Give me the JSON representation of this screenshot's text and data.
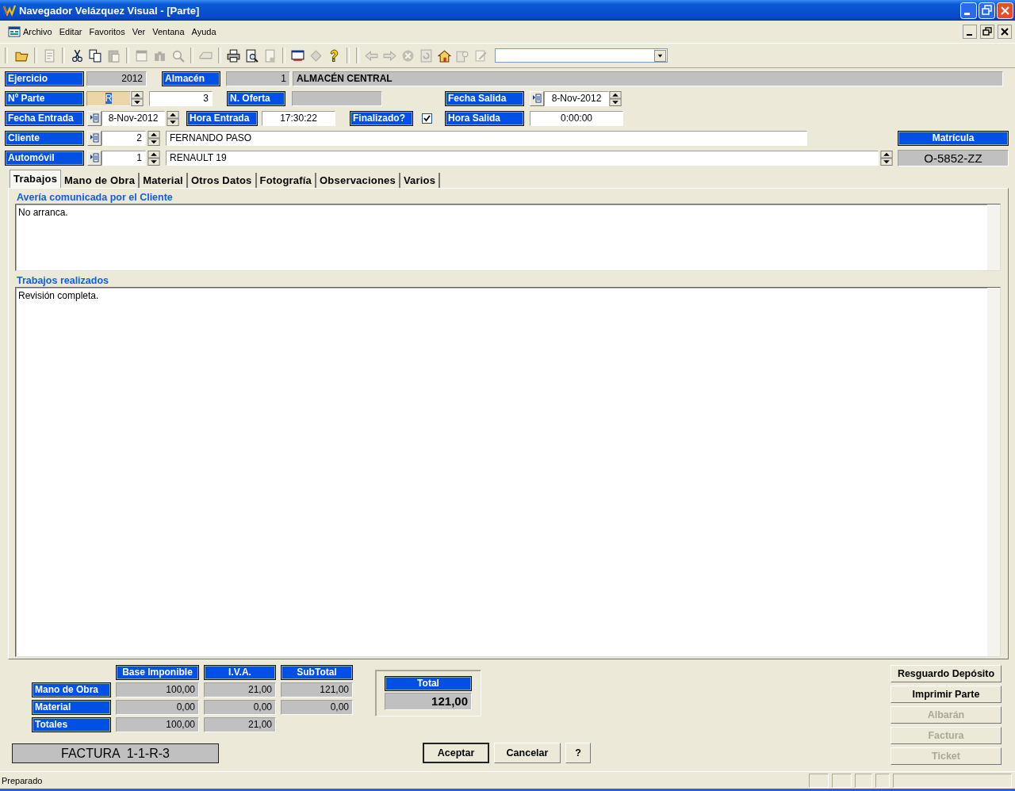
{
  "window": {
    "title": "Navegador Velázquez Visual - [Parte]"
  },
  "menu": [
    {
      "label": "Archivo"
    },
    {
      "label": "Editar"
    },
    {
      "label": "Favoritos"
    },
    {
      "label": "Ver"
    },
    {
      "label": "Ventana"
    },
    {
      "label": "Ayuda"
    }
  ],
  "toolbar": [
    {
      "buttons": [
        {
          "disabled": false
        }
      ]
    },
    {
      "buttons": [
        {
          "disabled": true
        }
      ]
    },
    {
      "buttons": [
        {
          "disabled": false
        },
        {
          "disabled": false
        },
        {
          "disabled": true
        }
      ]
    },
    {
      "buttons": [
        {
          "disabled": true
        },
        {
          "disabled": true
        },
        {
          "disabled": true
        }
      ]
    },
    {
      "buttons": [
        {
          "disabled": true
        }
      ]
    },
    {
      "buttons": [
        {
          "disabled": false
        },
        {
          "disabled": false
        },
        {
          "disabled": true
        }
      ]
    },
    {
      "buttons": [
        {
          "disabled": false
        },
        {
          "disabled": true
        },
        {
          "disabled": false
        }
      ]
    },
    {
      "buttons": [
        {
          "disabled": true
        },
        {
          "disabled": true
        },
        {
          "disabled": true
        },
        {
          "disabled": true
        },
        {
          "disabled": false
        },
        {
          "disabled": true
        },
        {
          "disabled": true
        }
      ]
    }
  ],
  "form": {
    "ejercicio": {
      "label": "Ejercicio",
      "value": "2012"
    },
    "almacen": {
      "label": "Almacén",
      "code": "1",
      "name": "ALMACÉN CENTRAL"
    },
    "parte": {
      "label": "Nº Parte",
      "serie": "R",
      "serie_selected": true,
      "number": "3"
    },
    "oferta": {
      "label": "N. Oferta"
    },
    "fecha_salida": {
      "label": "Fecha Salida",
      "value": "8-Nov-2012"
    },
    "fecha_entrada": {
      "label": "Fecha Entrada",
      "value": "8-Nov-2012"
    },
    "hora_entrada": {
      "label": "Hora Entrada",
      "value": "17:30:22"
    },
    "finalizado": {
      "label": "Finalizado?",
      "checked": true
    },
    "hora_salida": {
      "label": "Hora Salida",
      "value": "0:00:00"
    },
    "cliente": {
      "label": "Cliente",
      "code": "2",
      "name": "FERNANDO PASO"
    },
    "matricula": {
      "label": "Matrícula",
      "value": "O-5852-ZZ"
    },
    "automovil": {
      "label": "Automóvil",
      "code": "1",
      "name": "RENAULT 19"
    }
  },
  "tabs": [
    {
      "label": "Trabajos",
      "selected": true
    },
    {
      "label": "Mano de Obra",
      "selected": false
    },
    {
      "label": "Material",
      "selected": false
    },
    {
      "label": "Otros Datos",
      "selected": false
    },
    {
      "label": "Fotografía",
      "selected": false
    },
    {
      "label": "Observaciones",
      "selected": false
    },
    {
      "label": "Varios",
      "selected": false
    }
  ],
  "panel": {
    "averia": {
      "label": "Avería comunicada por el Cliente",
      "value": "No arranca."
    },
    "trabajos": {
      "label": "Trabajos realizados",
      "value": "Revisión completa."
    }
  },
  "totals": {
    "columns": [
      "Base Imponible",
      "I.V.A.",
      "SubTotal"
    ],
    "rows": [
      {
        "label": "Mano de Obra",
        "values": [
          "100,00",
          "21,00",
          "121,00"
        ]
      },
      {
        "label": "Material",
        "values": [
          "0,00",
          "0,00",
          "0,00"
        ]
      },
      {
        "label": "Totales",
        "values": [
          "100,00",
          "21,00"
        ]
      }
    ]
  },
  "total": {
    "label": "Total",
    "value": "121,00"
  },
  "factura": "FACTURA  1-1-R-3",
  "buttons": [
    {
      "label": "Aceptar",
      "default": true
    },
    {
      "label": "Cancelar",
      "default": false
    },
    {
      "label": "?",
      "default": false
    }
  ],
  "side_buttons": [
    {
      "label": "Resguardo Depósito",
      "disabled": false
    },
    {
      "label": "Imprimir Parte",
      "disabled": false
    },
    {
      "label": "Albarán",
      "disabled": true
    },
    {
      "label": "Factura",
      "disabled": true
    },
    {
      "label": "Ticket",
      "disabled": true
    }
  ],
  "status_bar": {
    "text": "Preparado"
  }
}
